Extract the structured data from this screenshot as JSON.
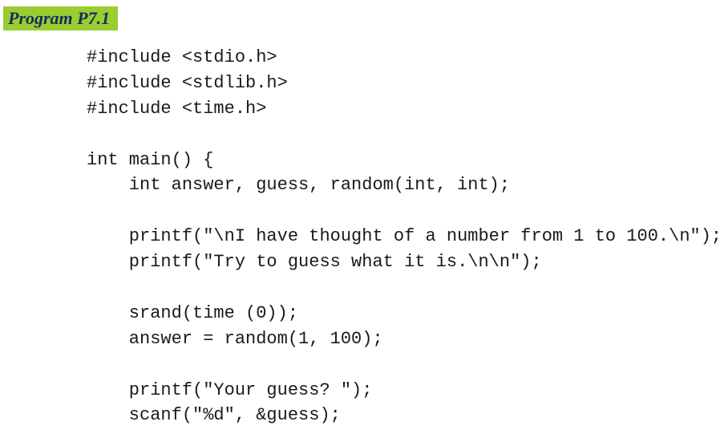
{
  "label": "Program P7.1",
  "code": "#include <stdio.h>\n#include <stdlib.h>\n#include <time.h>\n\nint main() {\n    int answer, guess, random(int, int);\n\n    printf(\"\\nI have thought of a number from 1 to 100.\\n\");\n    printf(\"Try to guess what it is.\\n\\n\");\n\n    srand(time (0));\n    answer = random(1, 100);\n\n    printf(\"Your guess? \");\n    scanf(\"%d\", &guess);"
}
